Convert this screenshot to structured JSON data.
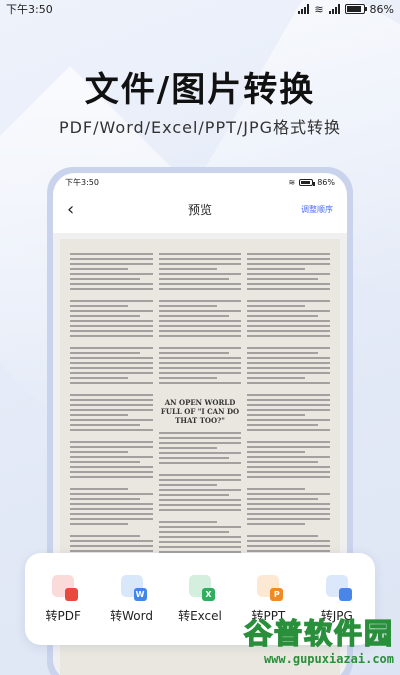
{
  "status_bar": {
    "time": "下午3:50",
    "battery": "86%"
  },
  "hero": {
    "title": "文件/图片转换",
    "subtitle": "PDF/Word/Excel/PPT/JPG格式转换"
  },
  "phone": {
    "status_bar": {
      "time": "下午3:50",
      "battery": "86%"
    },
    "nav": {
      "back_icon": "chevron-left-icon",
      "title": "预览",
      "action": "调整顺序"
    },
    "document": {
      "heading": "AN OPEN WORLD FULL OF \"I CAN DO THAT TOO?\""
    }
  },
  "tools": [
    {
      "label": "转PDF",
      "badge": "",
      "color": "#e8493f",
      "icon": "pdf-file-icon"
    },
    {
      "label": "转Word",
      "badge": "W",
      "color": "#3f88e8",
      "icon": "word-file-icon"
    },
    {
      "label": "转Excel",
      "badge": "X",
      "color": "#2fae5e",
      "icon": "excel-file-icon"
    },
    {
      "label": "转PPT",
      "badge": "P",
      "color": "#f08a24",
      "icon": "ppt-file-icon"
    },
    {
      "label": "转JPG",
      "badge": "",
      "color": "#4a86e8",
      "icon": "image-file-icon"
    }
  ],
  "watermark": {
    "text": "谷普软件园",
    "url": "www.gupuxiazai.com"
  }
}
